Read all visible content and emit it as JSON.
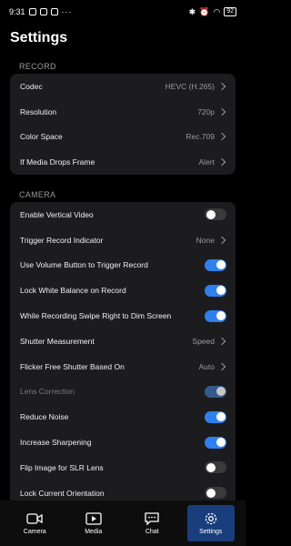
{
  "status_bar": {
    "time": "9:31",
    "battery": "92",
    "more": "···"
  },
  "title": "Settings",
  "record": {
    "label": "RECORD",
    "rows": [
      {
        "label": "Codec",
        "value": "HEVC (H.265)"
      },
      {
        "label": "Resolution",
        "value": "720p"
      },
      {
        "label": "Color Space",
        "value": "Rec.709"
      },
      {
        "label": "If Media Drops Frame",
        "value": "Alert"
      }
    ]
  },
  "camera": {
    "label": "CAMERA",
    "rows": [
      {
        "label": "Enable Vertical Video",
        "toggle": false
      },
      {
        "label": "Trigger Record Indicator",
        "value": "None"
      },
      {
        "label": "Use Volume Button to Trigger Record",
        "toggle": true
      },
      {
        "label": "Lock White Balance on Record",
        "toggle": true
      },
      {
        "label": "While Recording Swipe Right to Dim Screen",
        "toggle": true
      },
      {
        "label": "Shutter Measurement",
        "value": "Speed"
      },
      {
        "label": "Flicker Free Shutter Based On",
        "value": "Auto"
      },
      {
        "label": "Lens Correction",
        "toggle": true,
        "disabled": true
      },
      {
        "label": "Reduce Noise",
        "toggle": true
      },
      {
        "label": "Increase Sharpening",
        "toggle": true
      },
      {
        "label": "Flip Image for SLR Lens",
        "toggle": false
      },
      {
        "label": "Lock Current Orientation",
        "toggle": false
      }
    ]
  },
  "tabs": [
    {
      "label": "Camera",
      "icon": "camera-icon",
      "active": false
    },
    {
      "label": "Media",
      "icon": "media-icon",
      "active": false
    },
    {
      "label": "Chat",
      "icon": "chat-icon",
      "active": false
    },
    {
      "label": "Settings",
      "icon": "gear-icon",
      "active": true
    }
  ],
  "colors": {
    "accent": "#2f80ed",
    "background": "#000000",
    "card": "#1c1c1e",
    "active_tab": "#1a3d7c"
  }
}
